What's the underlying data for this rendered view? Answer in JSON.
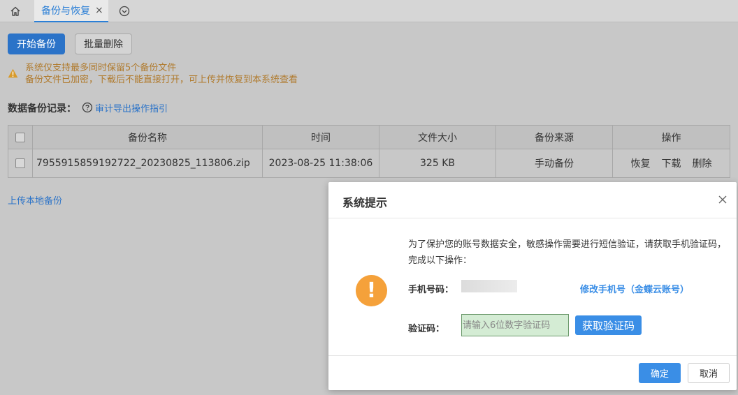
{
  "tabbar": {
    "active_tab": "备份与恢复",
    "close_symbol": "×",
    "home_icon": "home-icon",
    "more_icon": "chevron-circle-down-icon"
  },
  "toolbar": {
    "start_backup_label": "开始备份",
    "batch_delete_label": "批量删除"
  },
  "notice": {
    "line1": "系统仅支持最多同时保留5个备份文件",
    "line2": "备份文件已加密，下载后不能直接打开，可上传并恢复到本系统查看",
    "color": "#b07a2c"
  },
  "records": {
    "title": "数据备份记录：",
    "guide_link": "审计导出操作指引"
  },
  "table": {
    "headers": [
      "备份名称",
      "时间",
      "文件大小",
      "备份来源",
      "操作"
    ],
    "rows": [
      {
        "name": "7955915859192722_20230825_113806.zip",
        "time": "2023-08-25 11:38:06",
        "size": "325 KB",
        "source": "手动备份",
        "actions": [
          "恢复",
          "下载",
          "删除"
        ]
      }
    ]
  },
  "upload_link": "上传本地备份",
  "dialog": {
    "title": "系统提示",
    "message": "为了保护您的账号数据安全，敏感操作需要进行短信验证，请获取手机验证码，完成以下操作：",
    "phone_label": "手机号码：",
    "change_phone_link": "修改手机号（金蝶云账号）",
    "code_label": "验证码：",
    "code_placeholder": "请输入6位数字验证码",
    "get_code_label": "获取验证码",
    "ok_label": "确定",
    "cancel_label": "取消",
    "alert_symbol": "!",
    "accent_color": "#3a8ee6",
    "alert_color": "#f5a13a"
  }
}
